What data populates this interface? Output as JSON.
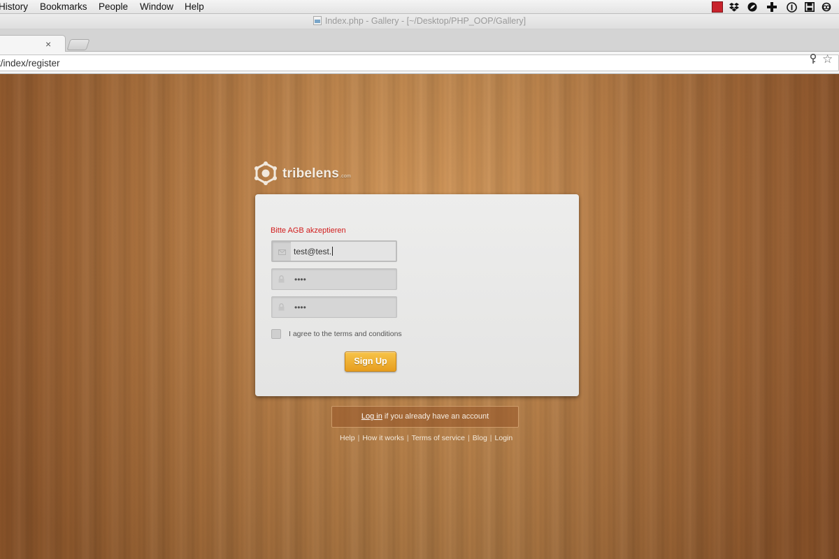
{
  "menubar": {
    "items": [
      "History",
      "Bookmarks",
      "People",
      "Window",
      "Help"
    ]
  },
  "window": {
    "title": "Index.php - Gallery - [~/Desktop/PHP_OOP/Gallery]"
  },
  "tabs": {
    "close_glyph": "×"
  },
  "address_bar": {
    "url": "t/index/register"
  },
  "logo": {
    "word": "tribelens",
    "suffix": ".com"
  },
  "form": {
    "error": "Bitte AGB akzeptieren",
    "email_value": "test@test.",
    "password_value": "••••",
    "password_confirm_value": "••••",
    "terms_label": "I agree to the terms and conditions",
    "terms_checked": false,
    "signup_label": "Sign Up"
  },
  "login_hint": {
    "link": "Log in",
    "text": " if you already have an account"
  },
  "footer": {
    "links": [
      "Help",
      "How it works",
      "Terms of service",
      "Blog",
      "Login"
    ],
    "separator": "|"
  },
  "colors": {
    "error": "#d11c1c",
    "button": "#f0b232"
  }
}
